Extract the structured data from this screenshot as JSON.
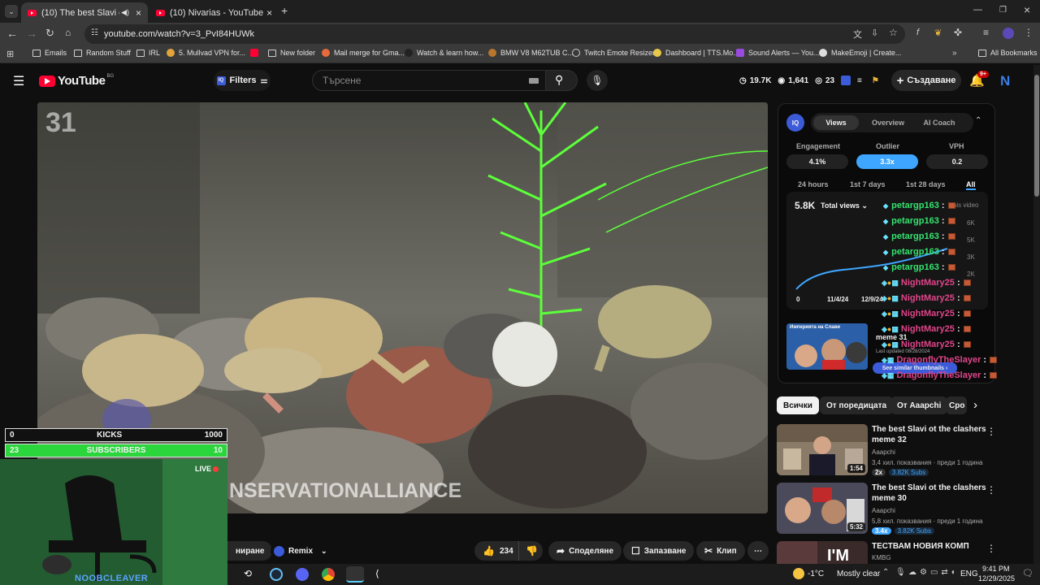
{
  "browser": {
    "tabs": [
      {
        "label": "(10) The best Slavi ot clashe",
        "active": true
      },
      {
        "label": "(10) Nivarias - YouTube",
        "active": false
      }
    ],
    "url": "youtube.com/watch?v=3_PvI84HUWk",
    "bookmarks": [
      "Emails",
      "Random Stuff",
      "IRL",
      "5. Mullvad VPN for...",
      "New folder",
      "Mail merge for Gma...",
      "Watch & learn how...",
      "BMW V8 M62TUB C...",
      "Twitch Emote Resizer",
      "Dashboard | TTS.Mo...",
      "Sound Alerts — You...",
      "MakeEmoji | Create..."
    ],
    "all_bookmarks": "All Bookmarks"
  },
  "yt": {
    "logo": "YouTube",
    "country": "BG",
    "filters": "Filters",
    "search_placeholder": "Търсене",
    "stats": {
      "views": "19.7K",
      "likes": "1,641",
      "count": "23"
    },
    "create": "Създаване",
    "notif": "9+",
    "avatar": "N"
  },
  "video": {
    "number": "31",
    "watermark": "NSERVATIONALLIANCE"
  },
  "overlay": {
    "kicks": {
      "left": "0",
      "label": "KICKS",
      "right": "1000"
    },
    "subs": {
      "left": "23",
      "label": "SUBSCRIBERS",
      "right": "10"
    },
    "live": "LIVE",
    "streamer": "NOOBCLEAVER"
  },
  "actions": {
    "partial": "ниране",
    "remix": "Remix",
    "likes": "234",
    "share": "Споделяне",
    "save": "Запазване",
    "clip": "Клип"
  },
  "panel": {
    "tabs": [
      "Views",
      "Overview",
      "AI Coach"
    ],
    "metrics": [
      {
        "label": "Engagement",
        "value": "4.1%"
      },
      {
        "label": "Outlier",
        "value": "3.3x"
      },
      {
        "label": "VPH",
        "value": "0.2"
      }
    ],
    "ranges": [
      "24 hours",
      "1st 7 days",
      "1st 28 days",
      "All"
    ],
    "chart_value": "5.8K",
    "chart_select": "Total views",
    "chart_x": [
      "0",
      "11/4/24",
      "12/9/24"
    ],
    "chart_y": [
      "6K",
      "5K",
      "3K",
      "2K"
    ],
    "this_video": "This video",
    "thumb_title": "Империята на Слави",
    "thumb_meme": "meme 31",
    "thumb_date": "Last updated 08/28/2024",
    "see_similar": "See similar thumbnails"
  },
  "chat": [
    {
      "name": "petargp163",
      "color": "green"
    },
    {
      "name": "petargp163",
      "color": "green"
    },
    {
      "name": "petargp163",
      "color": "green"
    },
    {
      "name": "petargp163",
      "color": "green"
    },
    {
      "name": "petargp163",
      "color": "green"
    },
    {
      "name": "NightMary25",
      "color": "pink"
    },
    {
      "name": "NightMary25",
      "color": "pink"
    },
    {
      "name": "NightMary25",
      "color": "pink"
    },
    {
      "name": "NightMary25",
      "color": "pink"
    },
    {
      "name": "NightMary25",
      "color": "pink"
    },
    {
      "name": "DragonflyTheSlayer",
      "color": "pink"
    },
    {
      "name": "DragonflyTheSlayer",
      "color": "pink"
    }
  ],
  "chips": [
    "Всички",
    "От поредицата",
    "От Aaapchi",
    "Сро"
  ],
  "recs": [
    {
      "title": "The best Slavi ot the clashers meme 32",
      "channel": "Aaapchi",
      "meta": "3,4 хил. показвания · преди 1 година",
      "badge1": "",
      "subs": "3.82K Subs",
      "duration": "1:54"
    },
    {
      "title": "The best Slavi ot the clashers meme 30",
      "channel": "Aaapchi",
      "meta": "5,8 хил. показвания · преди 1 година",
      "badge1": "3.4x",
      "subs": "3.82K Subs",
      "duration": "5:32"
    },
    {
      "title": "ТЕСТВАМ НОВИЯ КОМП",
      "channel": "KMBG",
      "meta": "",
      "badge1": "",
      "subs": "",
      "duration": ""
    }
  ],
  "rec0_badge": "2x",
  "taskbar": {
    "temp": "-1°C",
    "weather": "Mostly clear",
    "lang": "ENG",
    "time": "9:41 PM",
    "date": "12/29/2025"
  },
  "colors": {
    "accent": "#3ea6ff",
    "youtube_red": "#ff0033",
    "green": "#34e36f",
    "pink": "#e0458a"
  }
}
